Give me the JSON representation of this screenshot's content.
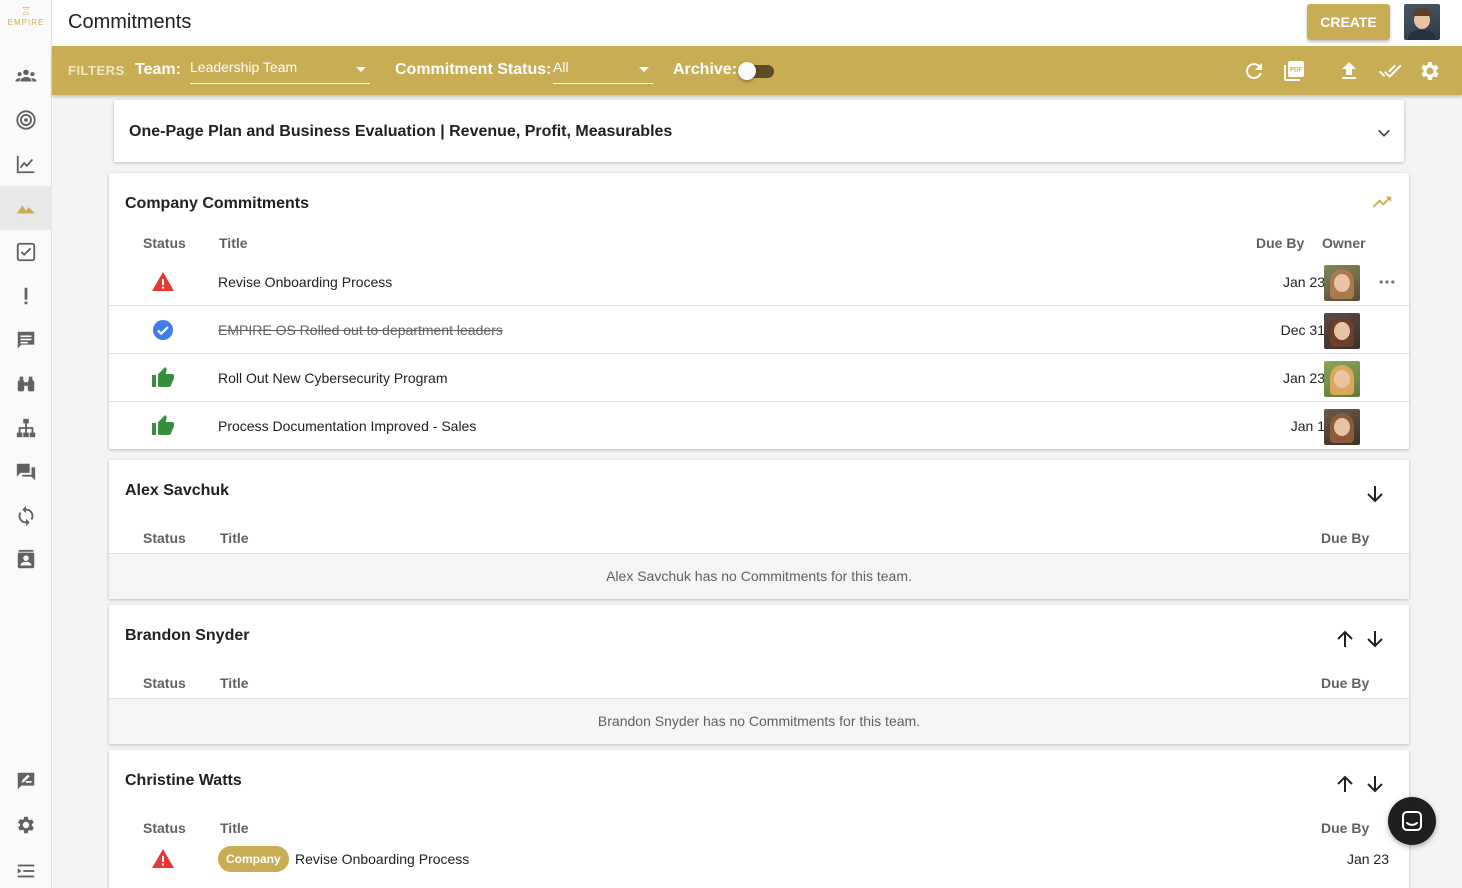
{
  "app": {
    "logo_text": "EMPIRE",
    "page_title": "Commitments",
    "create_label": "CREATE",
    "brand_color": "#c8ad55"
  },
  "sidebar": {
    "items": [
      {
        "name": "people-icon"
      },
      {
        "name": "target-icon"
      },
      {
        "name": "chart-line-icon"
      },
      {
        "name": "mountains-icon",
        "active": true
      },
      {
        "name": "check-box-icon"
      },
      {
        "name": "exclamation-icon"
      },
      {
        "name": "feedback-icon"
      },
      {
        "name": "binoculars-icon"
      },
      {
        "name": "org-chart-icon"
      },
      {
        "name": "forum-icon"
      },
      {
        "name": "sync-icon"
      },
      {
        "name": "contact-card-icon"
      },
      {
        "name": "rate-review-icon"
      },
      {
        "name": "settings-icon"
      },
      {
        "name": "collapse-menu-icon"
      }
    ]
  },
  "filters": {
    "label": "FILTERS",
    "team_label": "Team:",
    "team_value": "Leadership Team",
    "status_label": "Commitment Status:",
    "status_value": "All",
    "archive_label": "Archive:",
    "archive_on": false,
    "tools": [
      "refresh-icon",
      "pdf-icon",
      "upload-icon",
      "done-all-icon",
      "settings-icon"
    ]
  },
  "plan_panel": {
    "title": "One-Page Plan and Business Evaluation | Revenue, Profit, Measurables"
  },
  "company": {
    "title": "Company Commitments",
    "headers": {
      "status": "Status",
      "title": "Title",
      "due": "Due By",
      "owner": "Owner"
    },
    "rows": [
      {
        "status": "warning-icon",
        "title": "Revise Onboarding Process",
        "due": "Jan 23",
        "done": false
      },
      {
        "status": "check-circle-icon",
        "title": "EMPIRE OS Rolled out to department leaders",
        "due": "Dec 31",
        "done": true
      },
      {
        "status": "thumb-up-icon",
        "title": "Roll Out New Cybersecurity Program",
        "due": "Jan 23",
        "done": false
      },
      {
        "status": "thumb-up-icon",
        "title": "Process Documentation Improved - Sales",
        "due": "Jan 1",
        "done": false
      }
    ]
  },
  "people": [
    {
      "name": "Alex Savchuk",
      "headers": {
        "status": "Status",
        "title": "Title",
        "due": "Due By"
      },
      "empty": "Alex Savchuk has no Commitments for this team."
    },
    {
      "name": "Brandon Snyder",
      "headers": {
        "status": "Status",
        "title": "Title",
        "due": "Due By"
      },
      "empty": "Brandon Snyder has no Commitments for this team."
    },
    {
      "name": "Christine Watts",
      "headers": {
        "status": "Status",
        "title": "Title",
        "due": "Due By"
      },
      "rows": [
        {
          "status": "warning-icon",
          "chip": "Company",
          "title": "Revise Onboarding Process",
          "due": "Jan 23"
        }
      ]
    }
  ]
}
